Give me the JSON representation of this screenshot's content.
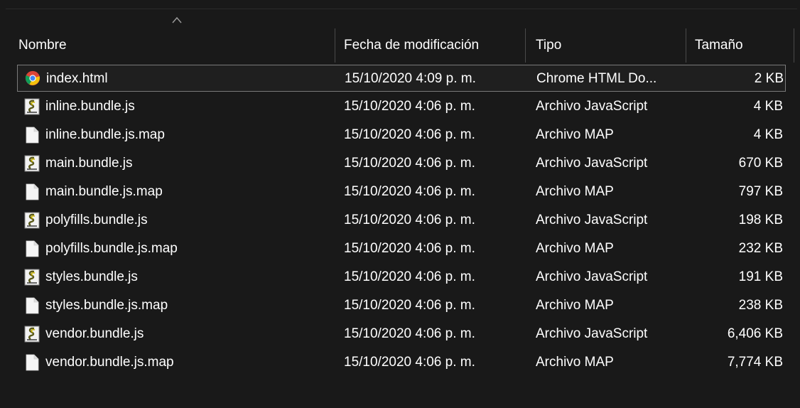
{
  "columns": {
    "name": "Nombre",
    "date": "Fecha de modificación",
    "type": "Tipo",
    "size": "Tamaño",
    "sorted_by": "name",
    "sort_direction": "ascending"
  },
  "files": [
    {
      "name": "index.html",
      "date": "15/10/2020 4:09 p. m.",
      "type": "Chrome HTML Do...",
      "size": "2 KB",
      "icon": "chrome-icon",
      "selected": true
    },
    {
      "name": "inline.bundle.js",
      "date": "15/10/2020 4:06 p. m.",
      "type": "Archivo JavaScript",
      "size": "4 KB",
      "icon": "javascript-file-icon"
    },
    {
      "name": "inline.bundle.js.map",
      "date": "15/10/2020 4:06 p. m.",
      "type": "Archivo MAP",
      "size": "4 KB",
      "icon": "blank-file-icon"
    },
    {
      "name": "main.bundle.js",
      "date": "15/10/2020 4:06 p. m.",
      "type": "Archivo JavaScript",
      "size": "670 KB",
      "icon": "javascript-file-icon"
    },
    {
      "name": "main.bundle.js.map",
      "date": "15/10/2020 4:06 p. m.",
      "type": "Archivo MAP",
      "size": "797 KB",
      "icon": "blank-file-icon"
    },
    {
      "name": "polyfills.bundle.js",
      "date": "15/10/2020 4:06 p. m.",
      "type": "Archivo JavaScript",
      "size": "198 KB",
      "icon": "javascript-file-icon"
    },
    {
      "name": "polyfills.bundle.js.map",
      "date": "15/10/2020 4:06 p. m.",
      "type": "Archivo MAP",
      "size": "232 KB",
      "icon": "blank-file-icon"
    },
    {
      "name": "styles.bundle.js",
      "date": "15/10/2020 4:06 p. m.",
      "type": "Archivo JavaScript",
      "size": "191 KB",
      "icon": "javascript-file-icon"
    },
    {
      "name": "styles.bundle.js.map",
      "date": "15/10/2020 4:06 p. m.",
      "type": "Archivo MAP",
      "size": "238 KB",
      "icon": "blank-file-icon"
    },
    {
      "name": "vendor.bundle.js",
      "date": "15/10/2020 4:06 p. m.",
      "type": "Archivo JavaScript",
      "size": "6,406 KB",
      "icon": "javascript-file-icon"
    },
    {
      "name": "vendor.bundle.js.map",
      "date": "15/10/2020 4:06 p. m.",
      "type": "Archivo MAP",
      "size": "7,774 KB",
      "icon": "blank-file-icon"
    }
  ],
  "colors": {
    "background": "#191919",
    "text": "#ffffff",
    "selection_border": "#7a7a7a",
    "separator": "#4a4a4a"
  }
}
